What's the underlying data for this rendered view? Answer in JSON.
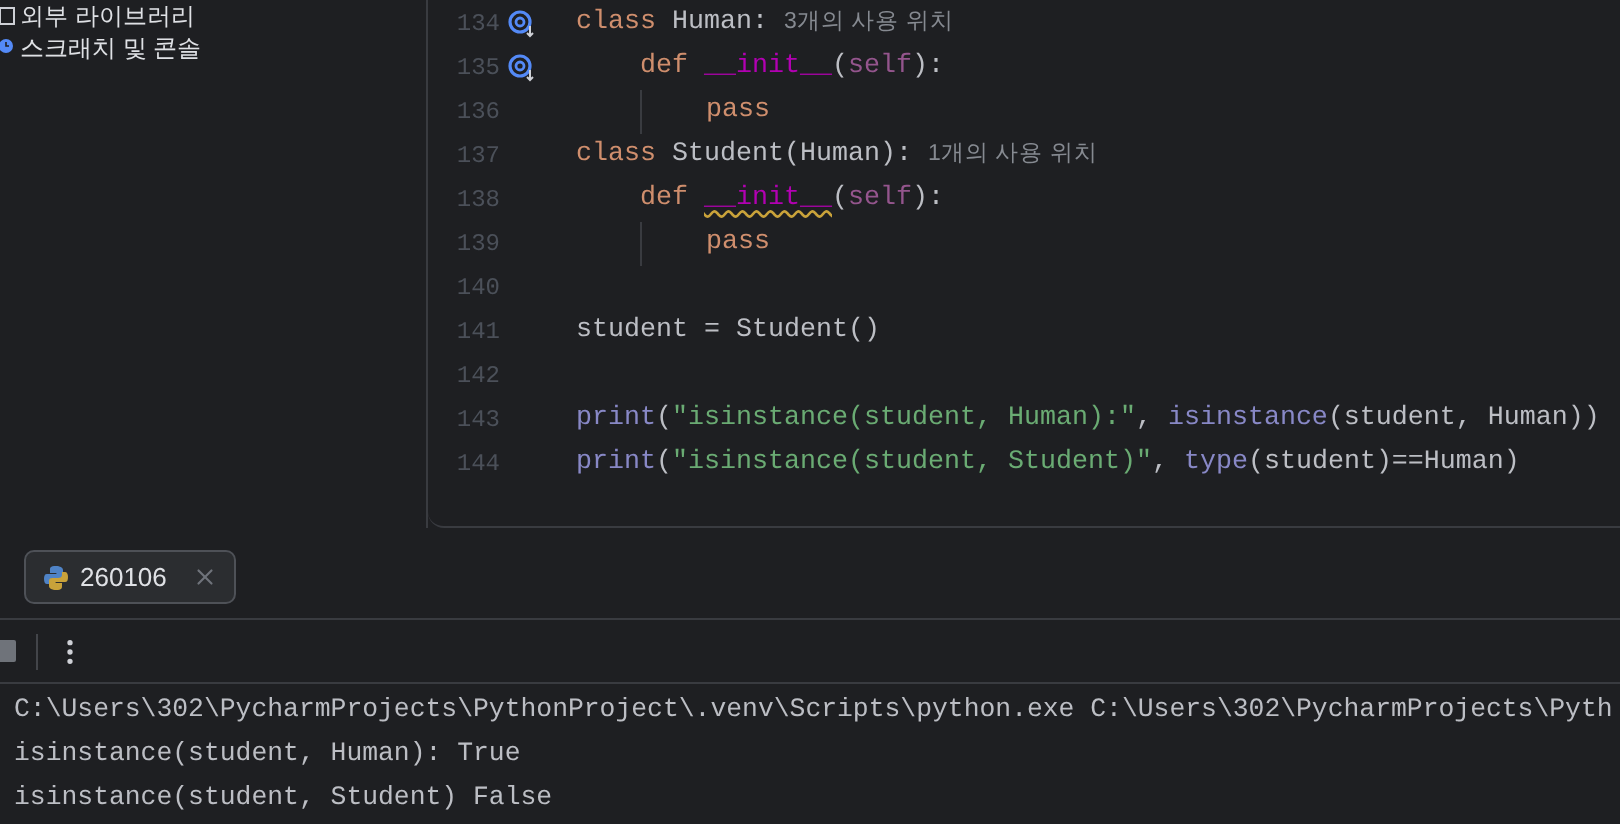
{
  "project_tree": {
    "items": [
      {
        "label": "외부 라이브러리",
        "kind": "library"
      },
      {
        "label": "스크래치 및 콘솔",
        "kind": "scratch"
      }
    ]
  },
  "editor": {
    "lines": [
      {
        "number": "134",
        "override_marker": true,
        "kind": "top",
        "tokens": [
          {
            "text": "class ",
            "kind": "keyword"
          },
          {
            "text": "Human:",
            "kind": "plain"
          }
        ],
        "hint": "3개의 사용 위치"
      },
      {
        "number": "135",
        "override_marker": true,
        "kind": "method",
        "tokens": [
          {
            "text": "def ",
            "kind": "keyword"
          },
          {
            "text": "__init__",
            "kind": "dunder"
          },
          {
            "text": "(",
            "kind": "plain"
          },
          {
            "text": "self",
            "kind": "self"
          },
          {
            "text": "):",
            "kind": "plain"
          }
        ]
      },
      {
        "number": "136",
        "override_marker": false,
        "kind": "body",
        "tokens": [
          {
            "text": "pass",
            "kind": "keyword"
          }
        ]
      },
      {
        "number": "137",
        "override_marker": false,
        "kind": "top",
        "tokens": [
          {
            "text": "class ",
            "kind": "keyword"
          },
          {
            "text": "Student(Human):",
            "kind": "plain"
          }
        ],
        "hint": "1개의 사용 위치"
      },
      {
        "number": "138",
        "override_marker": false,
        "kind": "method",
        "tokens": [
          {
            "text": "def ",
            "kind": "keyword"
          },
          {
            "text": "__init__",
            "kind": "dunder_warning"
          },
          {
            "text": "(",
            "kind": "plain"
          },
          {
            "text": "self",
            "kind": "self"
          },
          {
            "text": "):",
            "kind": "plain"
          }
        ]
      },
      {
        "number": "139",
        "override_marker": false,
        "kind": "body",
        "tokens": [
          {
            "text": "pass",
            "kind": "keyword"
          }
        ]
      },
      {
        "number": "140",
        "override_marker": false,
        "kind": "blank"
      },
      {
        "number": "141",
        "override_marker": false,
        "kind": "top",
        "tokens": [
          {
            "text": "student = Student()",
            "kind": "plain"
          }
        ]
      },
      {
        "number": "142",
        "override_marker": false,
        "kind": "blank"
      },
      {
        "number": "143",
        "override_marker": false,
        "kind": "top",
        "tokens": [
          {
            "text": "print",
            "kind": "builtin"
          },
          {
            "text": "(",
            "kind": "plain"
          },
          {
            "text": "\"isinstance(student, Human):\"",
            "kind": "string"
          },
          {
            "text": ", ",
            "kind": "plain"
          },
          {
            "text": "isinstance",
            "kind": "builtin"
          },
          {
            "text": "(student, Human))",
            "kind": "plain"
          }
        ]
      },
      {
        "number": "144",
        "override_marker": false,
        "kind": "top",
        "tokens": [
          {
            "text": "print",
            "kind": "builtin"
          },
          {
            "text": "(",
            "kind": "plain"
          },
          {
            "text": "\"isinstance(student, Student)\"",
            "kind": "string"
          },
          {
            "text": ", ",
            "kind": "plain"
          },
          {
            "text": "type",
            "kind": "builtin"
          },
          {
            "text": "(student)==Human)",
            "kind": "plain"
          }
        ]
      }
    ]
  },
  "run_panel": {
    "tabs": [
      {
        "label": "260106",
        "selected": true
      }
    ],
    "console": [
      {
        "text": "C:\\Users\\302\\PycharmProjects\\PythonProject\\.venv\\Scripts\\python.exe C:\\Users\\302\\PycharmProjects\\Pyth"
      },
      {
        "text": "isinstance(student, Human): True"
      },
      {
        "text": "isinstance(student, Student) False"
      }
    ]
  }
}
